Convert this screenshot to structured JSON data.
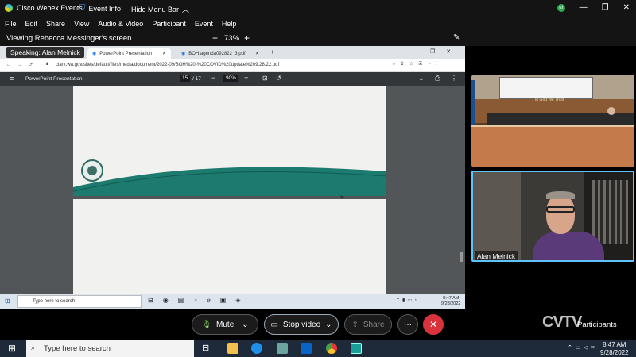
{
  "app": {
    "title": "Cisco Webex Events",
    "event_info": "Event Info",
    "hide_menu_bar": "Hide Menu Bar",
    "avatar_initials": "ul"
  },
  "menu": [
    "File",
    "Edit",
    "Share",
    "View",
    "Audio & Video",
    "Participant",
    "Event",
    "Help"
  ],
  "viewbar": {
    "viewing": "Viewing Rebecca Messinger's screen",
    "zoom": "73%"
  },
  "shared": {
    "speaking": "Speaking: Alan Melnick",
    "tabs": [
      "PowerPoint Presentation",
      "BOH.agenda092822_3.pdf"
    ],
    "url": "clark.wa.gov/sites/default/files/media/document/2022-09/BOH%20-%20COVID%20update%209.28.22.pdf",
    "pdf_title": "PowerPoint Presentation",
    "page_current": "15",
    "page_total": "/ 17",
    "pdf_zoom": "90%",
    "taskbar_search": "Type here to search",
    "time": "8:47 AM",
    "date": "9/28/2022"
  },
  "videos": {
    "chamber_sign": "In God We Trust",
    "speaker_name": "Alan Melnick"
  },
  "controls": {
    "mute": "Mute",
    "stop_video": "Stop video",
    "share": "Share",
    "more": "···",
    "participants": "Participants",
    "watermark": "CVTV"
  },
  "taskbar": {
    "search": "Type here to search",
    "time": "8:47 AM",
    "date": "9/28/2022"
  },
  "colors": {
    "accent_teal": "#1c7a6e",
    "end_red": "#d9323b",
    "webex_blue": "#2e7bd6"
  }
}
